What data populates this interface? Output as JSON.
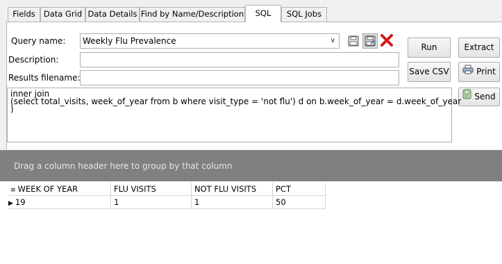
{
  "tabs": [
    {
      "label": "Fields"
    },
    {
      "label": "Data Grid"
    },
    {
      "label": "Data Details"
    },
    {
      "label": "Find by Name/Description"
    },
    {
      "label": "SQL"
    },
    {
      "label": "SQL Jobs"
    }
  ],
  "form": {
    "query_name_label": "Query name:",
    "query_name_value": "Weekly Flu Prevalence",
    "description_label": "Description:",
    "description_value": "",
    "results_label": "Results filename:",
    "results_value": ""
  },
  "buttons": {
    "run": "Run",
    "extract": "Extract",
    "save_csv": "Save CSV",
    "print": "Print",
    "send": "Send"
  },
  "sql": {
    "text": "inner join\n(select total_visits, week_of_year from b where visit_type = 'not flu') d on b.week_of_year = d.week_of_year\n)"
  },
  "grid": {
    "group_hint": "Drag a column header here to group by that column",
    "columns": [
      "WEEK OF YEAR",
      "FLU VISITS",
      "NOT FLU VISITS",
      "PCT"
    ],
    "rows": [
      [
        "19",
        "1",
        "1",
        "50"
      ]
    ]
  },
  "colors": {
    "group_bar": "#808080",
    "panel": "#ffffff",
    "chrome": "#f0f0f0"
  },
  "icons": [
    "save-icon",
    "save-as-icon",
    "delete-icon",
    "printer-icon",
    "send-icon",
    "row-pointer-icon",
    "grid-menu-icon"
  ]
}
